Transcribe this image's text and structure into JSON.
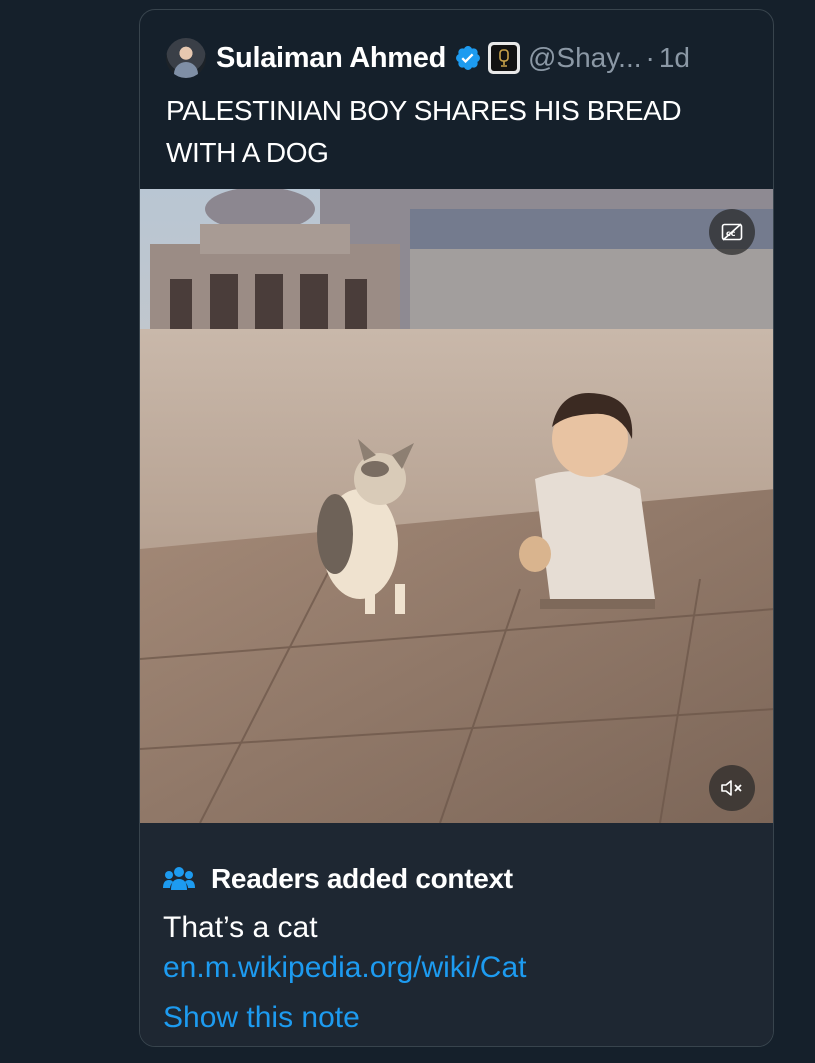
{
  "tweet": {
    "author_name": "Sulaiman Ahmed",
    "handle": "@Shay...",
    "separator": "·",
    "time": "1d",
    "text": "PALESTINIAN BOY SHARES HIS BREAD WITH A DOG"
  },
  "media": {
    "captions_icon": "captions-off-icon",
    "mute_icon": "volume-muted-icon"
  },
  "community_note": {
    "title": "Readers added context",
    "text": "That’s a cat",
    "link": "en.m.wikipedia.org/wiki/Cat",
    "show_note_label": "Show this note"
  },
  "colors": {
    "background": "#15202b",
    "note_background": "#1e2732",
    "accent": "#1d9bf0",
    "verified": "#1d9bf0",
    "secondary_text": "#8b98a5",
    "border": "#38444d"
  }
}
